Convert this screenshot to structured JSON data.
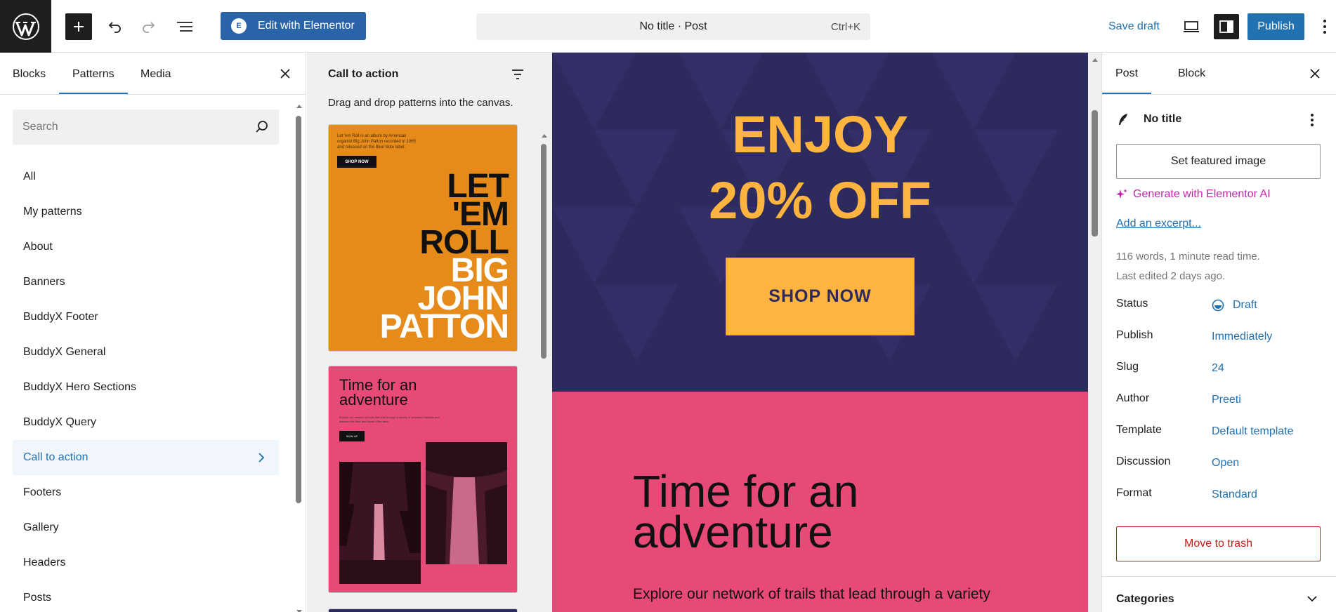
{
  "topbar": {
    "elementor_label": "Edit with Elementor",
    "elementor_badge": "E",
    "doc_title": "No title · Post",
    "shortcut": "Ctrl+K",
    "save_draft": "Save draft",
    "publish": "Publish"
  },
  "inserter": {
    "tabs": [
      "Blocks",
      "Patterns",
      "Media"
    ],
    "active_tab": "Patterns",
    "search_placeholder": "Search",
    "categories": [
      "All",
      "My patterns",
      "About",
      "Banners",
      "BuddyX Footer",
      "BuddyX General",
      "BuddyX Hero Sections",
      "BuddyX Query",
      "Call to action",
      "Footers",
      "Gallery",
      "Headers",
      "Posts"
    ],
    "active_category": "Call to action"
  },
  "patterns": {
    "title": "Call to action",
    "description": "Drag and drop patterns into the canvas.",
    "card1": {
      "small_text": "Let 'em Roll is an album by American organist Big John Patton recorded in 1965 and released on the Blue Note label.",
      "button": "SHOP NOW",
      "lines_dark": [
        "LET",
        "'EM",
        "ROLL"
      ],
      "lines_light": [
        "BIG",
        "JOHN",
        "PATTON"
      ]
    },
    "card2": {
      "title_line1": "Time for an",
      "title_line2": "adventure",
      "small_text": "Explore our network of trails that lead through a variety of woodland habitats and discover the flora and fauna of the area.",
      "button": "SIGN UP"
    }
  },
  "canvas": {
    "heading_line1": "ENJOY",
    "heading_line2": "20% OFF",
    "button": "SHOP NOW",
    "section2_title_line1": "Time for an",
    "section2_title_line2": "adventure",
    "section2_body": "Explore our network of trails that lead through a variety"
  },
  "settings": {
    "tabs": [
      "Post",
      "Block"
    ],
    "active_tab": "Post",
    "doc_title": "No title",
    "featured_image": "Set featured image",
    "generate_ai": "Generate with Elementor AI",
    "excerpt": "Add an excerpt...",
    "meta_words": "116 words, 1 minute read time.",
    "meta_edited": "Last edited 2 days ago.",
    "rows": [
      {
        "label": "Status",
        "value": "Draft"
      },
      {
        "label": "Publish",
        "value": "Immediately"
      },
      {
        "label": "Slug",
        "value": "24"
      },
      {
        "label": "Author",
        "value": "Preeti"
      },
      {
        "label": "Template",
        "value": "Default template"
      },
      {
        "label": "Discussion",
        "value": "Open"
      },
      {
        "label": "Format",
        "value": "Standard"
      }
    ],
    "trash": "Move to trash",
    "categories": "Categories"
  },
  "colors": {
    "accent": "#2271b1",
    "cta_navy": "#2d2a5e",
    "cta_orange": "#ffb43f",
    "cta_pink": "#e84a78",
    "pattern_orange": "#e68b1a",
    "ai_magenta": "#c026a7",
    "danger": "#cc1818"
  }
}
